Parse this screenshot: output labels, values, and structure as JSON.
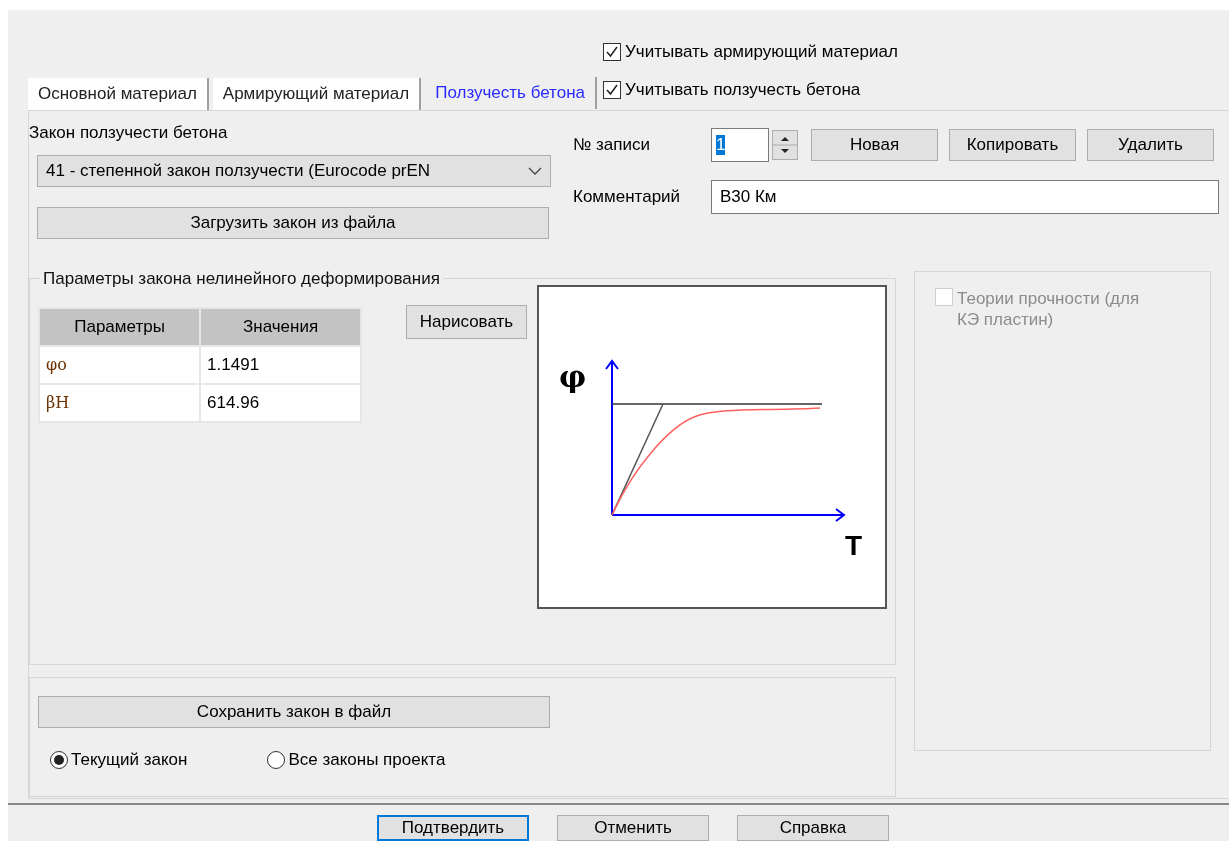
{
  "options": [
    {
      "label": "Учитывать армирующий материал",
      "checked": true
    },
    {
      "label": "Учитывать ползучесть бетона",
      "checked": true
    }
  ],
  "tabs": [
    {
      "label": "Основной материал",
      "selected": false
    },
    {
      "label": "Армирующий материал",
      "selected": false
    },
    {
      "label": "Ползучесть бетона",
      "selected": true
    }
  ],
  "law": {
    "label": "Закон ползучести бетона",
    "value": "41 - степенной закон ползучести (Eurocode prEN",
    "load_button": "Загрузить закон из файла"
  },
  "record": {
    "label": "№ записи",
    "value": "1",
    "buttons": [
      "Новая",
      "Копировать",
      "Удалить"
    ],
    "comment_label": "Комментарий",
    "comment": "B30 Км"
  },
  "params": {
    "title": "Параметры закона нелинейного деформирования",
    "columns": [
      "Параметры",
      "Значения"
    ],
    "rows": [
      {
        "name": "φo",
        "value": "1.1491"
      },
      {
        "name": "βH",
        "value": "614.96"
      }
    ],
    "draw_button": "Нарисовать",
    "plot": {
      "y_label": "φ",
      "x_label": "T"
    }
  },
  "strength": {
    "label": "Теории прочности (для КЭ пластин)",
    "checked": false,
    "disabled": true
  },
  "save": {
    "button": "Сохранить закон в файл",
    "scope": [
      {
        "label": "Текущий закон",
        "selected": true
      },
      {
        "label": "Все законы проекта",
        "selected": false
      }
    ]
  },
  "footer": [
    {
      "label": "Подтвердить",
      "focused": true
    },
    {
      "label": "Отменить",
      "focused": false
    },
    {
      "label": "Справка",
      "focused": false
    }
  ]
}
